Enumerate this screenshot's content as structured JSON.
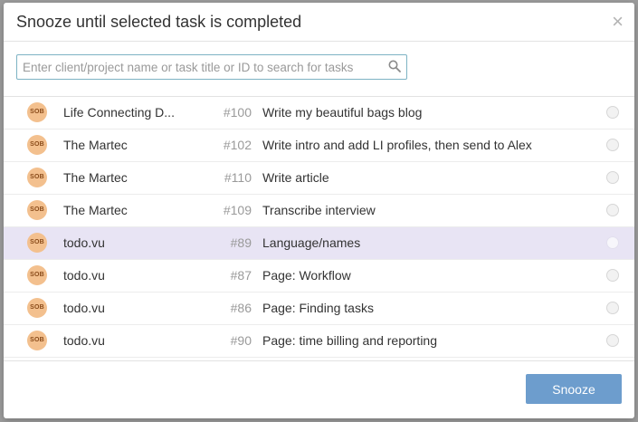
{
  "modal": {
    "title": "Snooze until selected task is completed",
    "close_icon": "close-icon",
    "close_glyph": "×"
  },
  "search": {
    "placeholder": "Enter client/project name or task title or ID to search for tasks",
    "icon": "search-icon"
  },
  "tasks": [
    {
      "avatar": "SOB",
      "client": "Life Connecting D...",
      "id": "#100",
      "title": "Write my beautiful bags blog",
      "selected": false
    },
    {
      "avatar": "SOB",
      "client": "The Martec",
      "id": "#102",
      "title": "Write intro and add LI profiles, then send to Alex",
      "selected": false
    },
    {
      "avatar": "SOB",
      "client": "The Martec",
      "id": "#110",
      "title": "Write article",
      "selected": false
    },
    {
      "avatar": "SOB",
      "client": "The Martec",
      "id": "#109",
      "title": "Transcribe interview",
      "selected": false
    },
    {
      "avatar": "SOB",
      "client": "todo.vu",
      "id": "#89",
      "title": "Language/names",
      "selected": true
    },
    {
      "avatar": "SOB",
      "client": "todo.vu",
      "id": "#87",
      "title": "Page: Workflow",
      "selected": false
    },
    {
      "avatar": "SOB",
      "client": "todo.vu",
      "id": "#86",
      "title": "Page: Finding tasks",
      "selected": false
    },
    {
      "avatar": "SOB",
      "client": "todo.vu",
      "id": "#90",
      "title": "Page: time billing and reporting",
      "selected": false
    }
  ],
  "footer": {
    "snooze_label": "Snooze"
  },
  "colors": {
    "accent": "#6d9dcd",
    "selected_row": "#e8e4f4",
    "avatar_bg": "#f3c08e",
    "search_border": "#7db3c4"
  }
}
